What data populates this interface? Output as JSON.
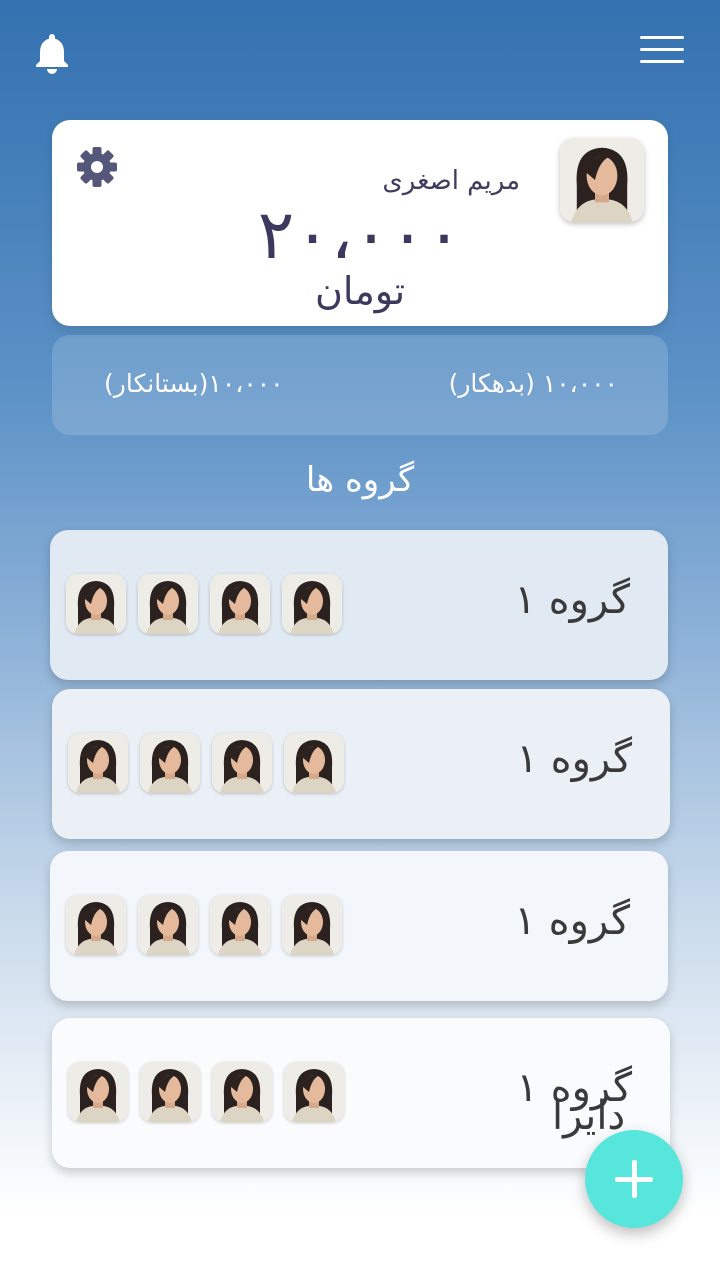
{
  "header": {
    "notification_icon": "bell-icon",
    "menu_icon": "hamburger-menu-icon"
  },
  "profile": {
    "name": "مریم اصغری",
    "balance": "۲۰،۰۰۰",
    "currency": "تومان",
    "settings_icon": "gear-icon"
  },
  "summary": {
    "debtor": "۱۰،۰۰۰ (بدهکار)",
    "creditor": "۱۰،۰۰۰(بستانکار)"
  },
  "groups_title": "گروه ها",
  "groups": [
    {
      "name": "گروه ۱",
      "members": [
        "avatar",
        "avatar",
        "avatar",
        "avatar"
      ]
    },
    {
      "name": "گروه ۱",
      "members": [
        "avatar",
        "avatar",
        "avatar",
        "avatar"
      ]
    },
    {
      "name": "گروه ۱",
      "members": [
        "avatar",
        "avatar",
        "avatar",
        "avatar"
      ]
    },
    {
      "name": "گروه ۱",
      "members": [
        "avatar",
        "avatar",
        "avatar",
        "avatar"
      ]
    }
  ],
  "overlap_label": "دایرا",
  "fab": {
    "icon": "plus-icon"
  },
  "colors": {
    "accent": "#56e6dc",
    "text_dark": "#3b3a5e",
    "header_blue": "#3471b0"
  }
}
